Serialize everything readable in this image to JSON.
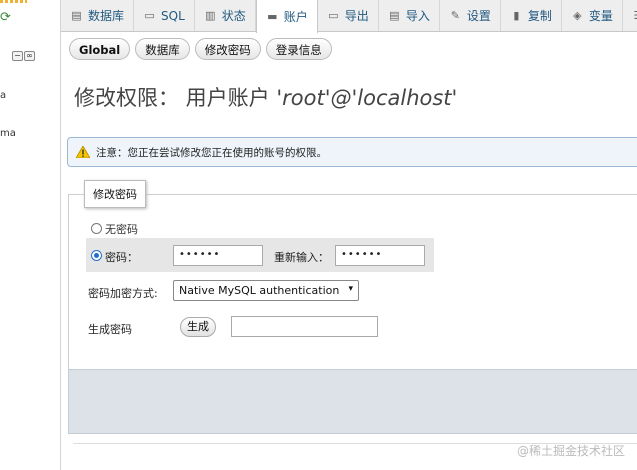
{
  "nav": {
    "db_items": [
      "a",
      "ma"
    ]
  },
  "menu": {
    "tabs": [
      {
        "label": "数据库",
        "icon": "database-icon"
      },
      {
        "label": "SQL",
        "icon": "sql-icon"
      },
      {
        "label": "状态",
        "icon": "status-icon"
      },
      {
        "label": "账户",
        "icon": "accounts-icon",
        "active": true
      },
      {
        "label": "导出",
        "icon": "export-icon"
      },
      {
        "label": "导入",
        "icon": "import-icon"
      },
      {
        "label": "设置",
        "icon": "settings-icon"
      },
      {
        "label": "复制",
        "icon": "replication-icon"
      },
      {
        "label": "变量",
        "icon": "variables-icon"
      }
    ]
  },
  "subtabs": [
    "Global",
    "数据库",
    "修改密码",
    "登录信息"
  ],
  "title": {
    "prefix": "修改权限： 用户账户",
    "user": "'root'@'localhost'"
  },
  "notice": {
    "text": "注意：您正在尝试修改您正在使用的账号的权限。"
  },
  "form": {
    "legend": "修改密码",
    "no_password_label": "无密码",
    "password_label": "密码：",
    "password_value": "••••••",
    "reenter_label": "重新输入：",
    "reenter_value": "••••••",
    "hashing_label": "密码加密方式:",
    "hashing_value": "Native MySQL authentication",
    "generate_label": "生成密码",
    "generate_button": "生成",
    "generated_value": ""
  },
  "watermark": "@稀土掘金技术社区",
  "colors": {
    "link": "#235a81",
    "notice_bg": "#eef4fa",
    "footer_bg": "#dde2e8"
  }
}
